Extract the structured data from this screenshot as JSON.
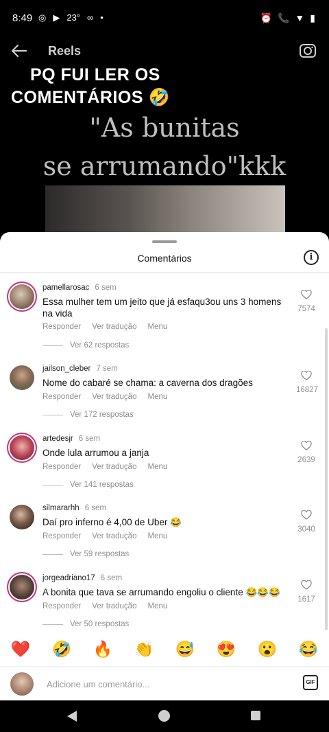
{
  "status_bar": {
    "time": "8:49",
    "left_icons": [
      "◎",
      "▶",
      "23°",
      "∞",
      "•"
    ],
    "right_icons": [
      "⏰",
      "📞",
      "▼",
      "▮"
    ]
  },
  "header": {
    "title": "Reels"
  },
  "overlay": {
    "line1": "PQ FUI LER OS",
    "line2": "COMENTÁRIOS 🤣",
    "quote1": "\"As bunitas",
    "quote2": "se arrumando\"kkk"
  },
  "sheet": {
    "title": "Comentários"
  },
  "comments": [
    {
      "username": "pamellarosac",
      "time": "6 sem",
      "text": "Essa mulher tem um jeito que já esfaqu3ou uns 3 homens na vida",
      "reply": "Responder",
      "translate": "Ver tradução",
      "menu": "Menu",
      "replies": "Ver 62 respostas",
      "likes": "7574"
    },
    {
      "username": "jailson_cleber",
      "time": "7 sem",
      "text": "Nome do cabaré se chama: a caverna dos dragões",
      "reply": "Responder",
      "translate": "Ver tradução",
      "menu": "Menu",
      "replies": "Ver 172 respostas",
      "likes": "16827"
    },
    {
      "username": "artedesjr",
      "time": "6 sem",
      "text": "Onde lula arrumou a janja",
      "reply": "Responder",
      "translate": "Ver tradução",
      "menu": "Menu",
      "replies": "Ver 141 respostas",
      "likes": "2639"
    },
    {
      "username": "silmararhh",
      "time": "6 sem",
      "text": "Daí pro inferno é 4,00 de Uber 😂",
      "reply": "Responder",
      "translate": "Ver tradução",
      "menu": "Menu",
      "replies": "Ver 59 respostas",
      "likes": "3040"
    },
    {
      "username": "jorgeadriano17",
      "time": "6 sem",
      "text": "A bonita que tava se arrumando engoliu o cliente 😂😂😂",
      "reply": "Responder",
      "translate": "Ver tradução",
      "menu": "Menu",
      "replies": "Ver 50 respostas",
      "likes": "1617"
    }
  ],
  "emojis": [
    "❤️",
    "🤣",
    "🔥",
    "👏",
    "😅",
    "😍",
    "😮",
    "😂"
  ],
  "composer": {
    "placeholder": "Adicione um comentário...",
    "gif_label": "GIF"
  },
  "colors": {
    "story_ring": "#c13584",
    "muted_text": "#8e8e8e"
  }
}
